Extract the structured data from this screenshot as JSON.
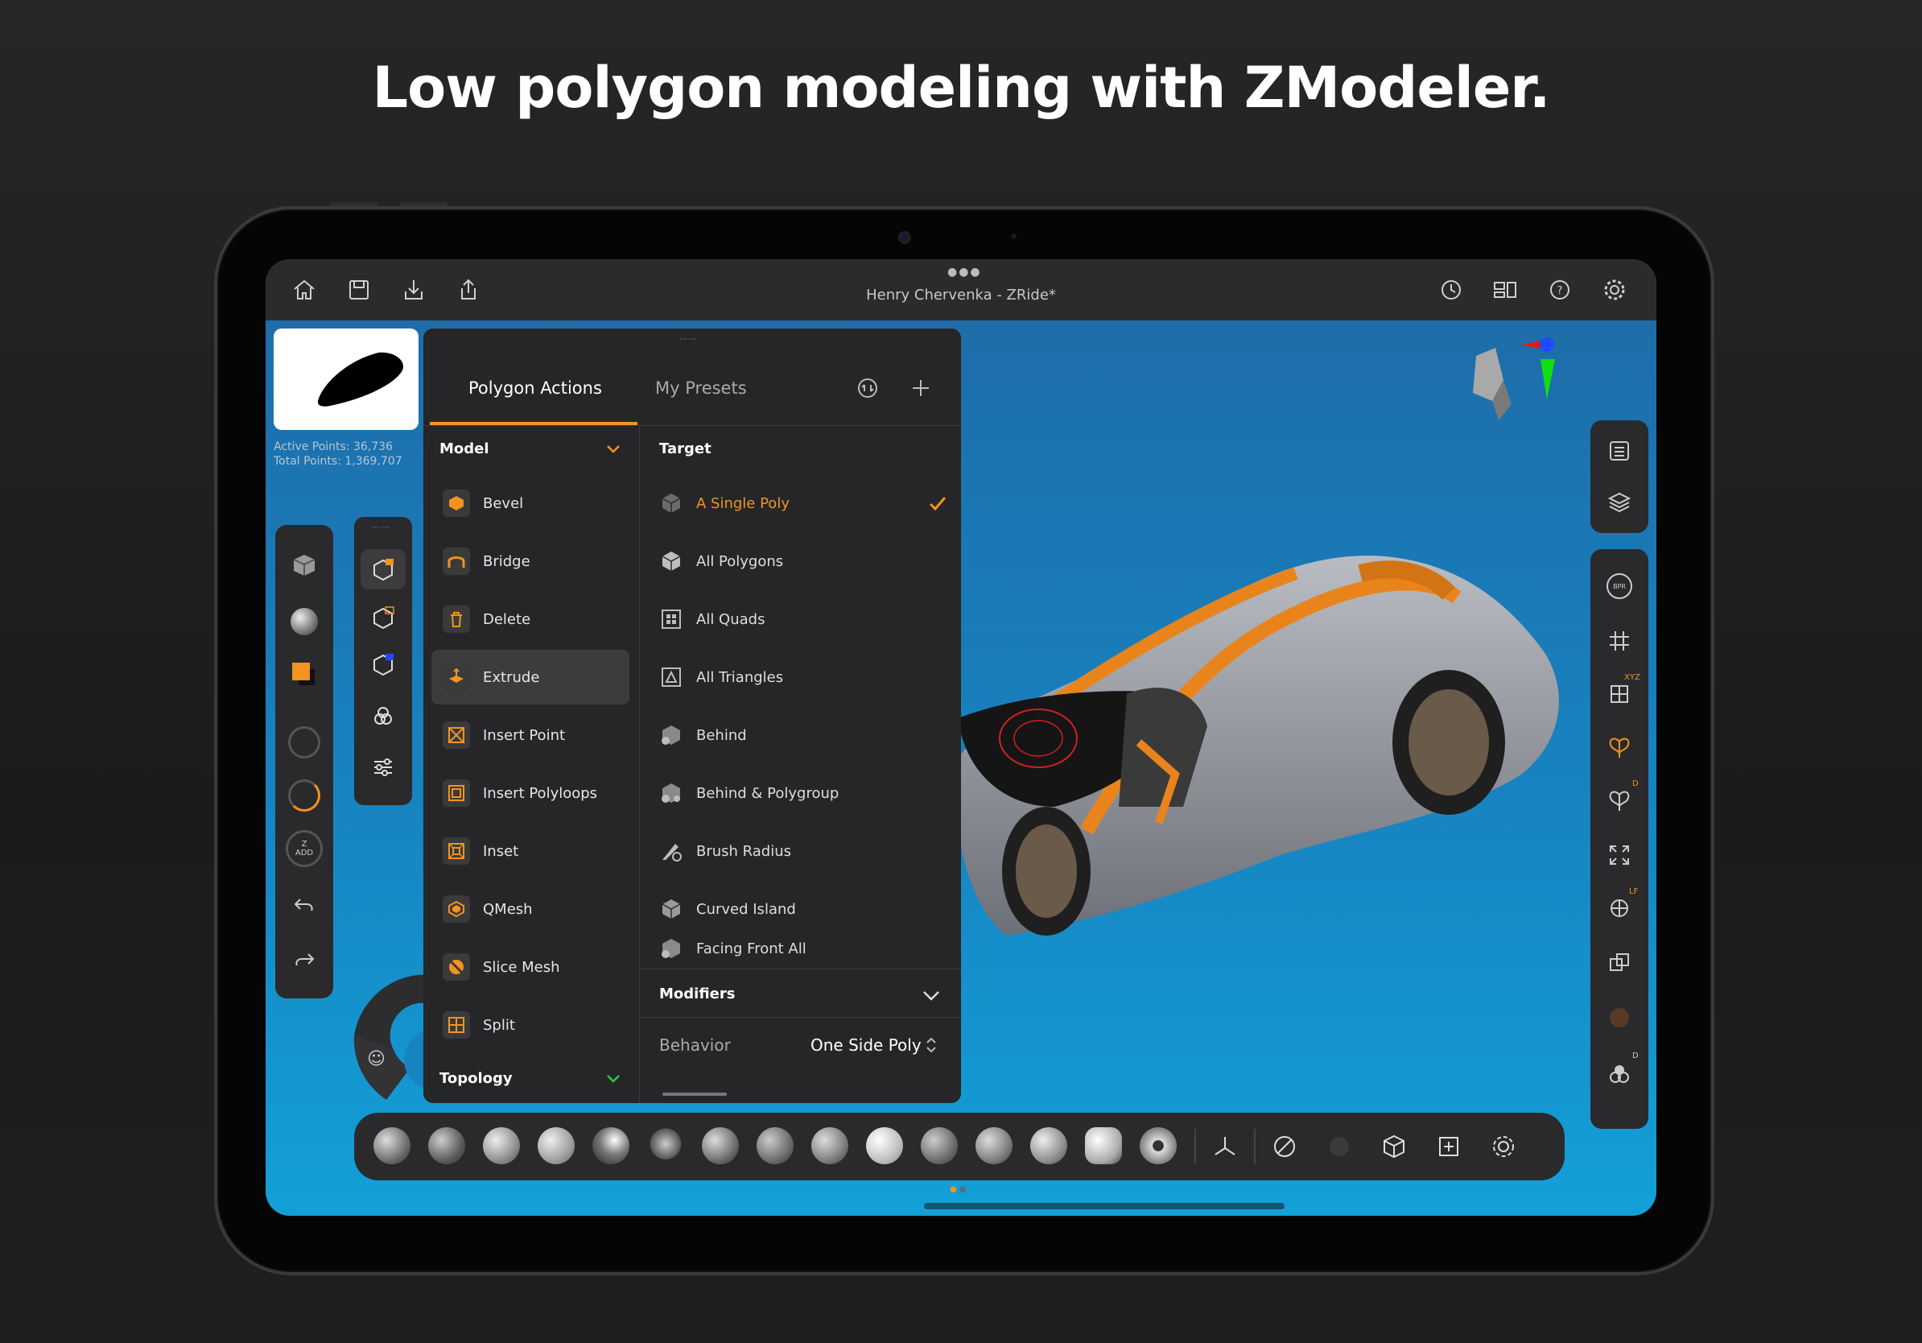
{
  "headline": "Low polygon modeling with ZModeler.",
  "topbar": {
    "title": "Henry Chervenka - ZRide*",
    "left_icons": [
      "home-icon",
      "save-icon",
      "import-icon",
      "share-icon"
    ],
    "right_icons": [
      "history-icon",
      "layout-icon",
      "help-icon",
      "settings-icon"
    ]
  },
  "stats": {
    "active_points": "Active Points: 36,736",
    "total_points": "Total Points: 1,369,707"
  },
  "panel": {
    "tabs": [
      {
        "label": "Polygon Actions"
      },
      {
        "label": "My Presets"
      }
    ],
    "model_section": "Model",
    "topology_section": "Topology",
    "actions": [
      {
        "label": "Bevel"
      },
      {
        "label": "Bridge"
      },
      {
        "label": "Delete"
      },
      {
        "label": "Extrude"
      },
      {
        "label": "Insert Point"
      },
      {
        "label": "Insert Polyloops"
      },
      {
        "label": "Inset"
      },
      {
        "label": "QMesh"
      },
      {
        "label": "Slice Mesh"
      },
      {
        "label": "Split"
      }
    ],
    "selected_action": "Extrude",
    "target_section": "Target",
    "targets": [
      {
        "label": "A Single Poly"
      },
      {
        "label": "All Polygons"
      },
      {
        "label": "All Quads"
      },
      {
        "label": "All Triangles"
      },
      {
        "label": "Behind"
      },
      {
        "label": "Behind & Polygroup"
      },
      {
        "label": "Brush Radius"
      },
      {
        "label": "Curved Island"
      },
      {
        "label": "Facing Front All"
      }
    ],
    "selected_target": "A Single Poly",
    "modifiers_section": "Modifiers",
    "behavior_label": "Behavior",
    "behavior_value": "One Side Poly"
  },
  "left_tools": {
    "z_add_top": "Z",
    "z_add_bottom": "ADD"
  },
  "right_tools": {
    "badge_xyz": "XYZ",
    "badge_d": "D",
    "badge_lf": "LF",
    "badge_d2": "D"
  },
  "colors": {
    "accent": "#f39320",
    "panel_bg": "#262628",
    "topbar_bg": "#2b2b2d",
    "viewport_top": "#1f6aa6",
    "viewport_bottom": "#13a0d8"
  }
}
